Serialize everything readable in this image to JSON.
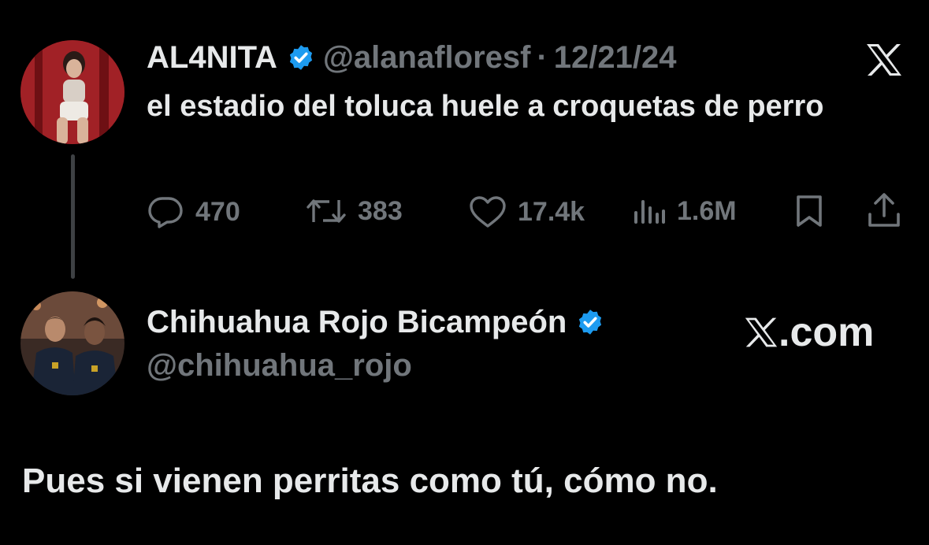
{
  "tweet": {
    "author_name": "AL4NITA",
    "handle": "@alanafloresf",
    "separator": "·",
    "date": "12/21/24",
    "text": "el estadio del toluca huele a croquetas de perro",
    "actions": {
      "replies": "470",
      "retweets": "383",
      "likes": "17.4k",
      "views": "1.6M"
    }
  },
  "reply_author": {
    "name": "Chihuahua Rojo Bicampeón",
    "handle": "@chihuahua_rojo"
  },
  "branding": {
    "site": ".com"
  },
  "reply_text": "Pues si vienen perritas como tú, cómo no.",
  "colors": {
    "background": "#000000",
    "text": "#e7e9ea",
    "muted": "#71767b",
    "verified": "#1d9bf0",
    "thread_line": "#3e4144"
  },
  "icons": [
    "x-logo-icon",
    "verified-badge-icon",
    "reply-icon",
    "retweet-icon",
    "like-icon",
    "views-icon",
    "bookmark-icon",
    "share-icon"
  ]
}
